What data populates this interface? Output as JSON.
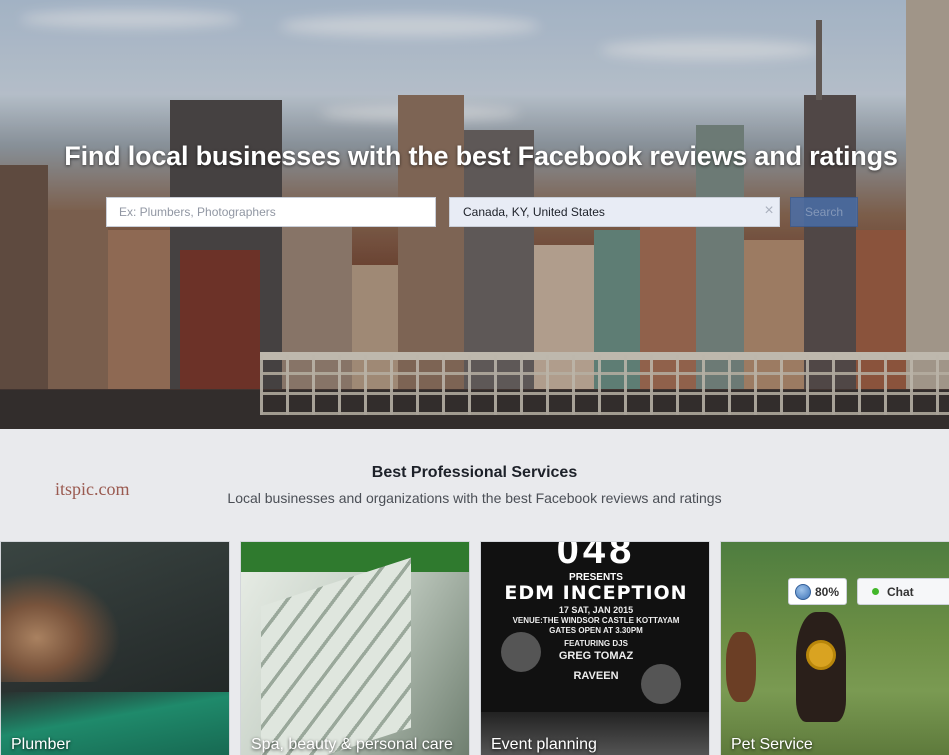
{
  "hero": {
    "title": "Find local businesses with the best Facebook reviews and ratings",
    "search_placeholder": "Ex: Plumbers, Photographers",
    "location_value": "Canada, KY, United States",
    "search_label": "Search",
    "clear_glyph": "×"
  },
  "section": {
    "title": "Best Professional Services",
    "subtitle": "Local businesses and organizations with the best Facebook reviews and ratings",
    "watermark": "itspic.com"
  },
  "categories": [
    {
      "label": "Plumber"
    },
    {
      "label": "Spa, beauty & personal care"
    },
    {
      "label": "Event planning"
    },
    {
      "label": "Pet Service"
    }
  ],
  "event_poster": {
    "top": "048",
    "presents": "PRESENTS",
    "title": "EDM INCEPTION",
    "date": "17 SAT, JAN 2015",
    "venue": "VENUE:THE WINDSOR CASTLE KOTTAYAM",
    "gates": "GATES OPEN AT 3.30PM",
    "featuring": "FEATURING DJS",
    "dj1": "GREG TOMAZ",
    "dj2": "RAVEEN"
  },
  "chat": {
    "progress_label": "80%",
    "chat_label": "Chat"
  },
  "colors": {
    "brand_button": "#4a6ea8",
    "online": "#42b72a",
    "background": "#e9eaed"
  }
}
